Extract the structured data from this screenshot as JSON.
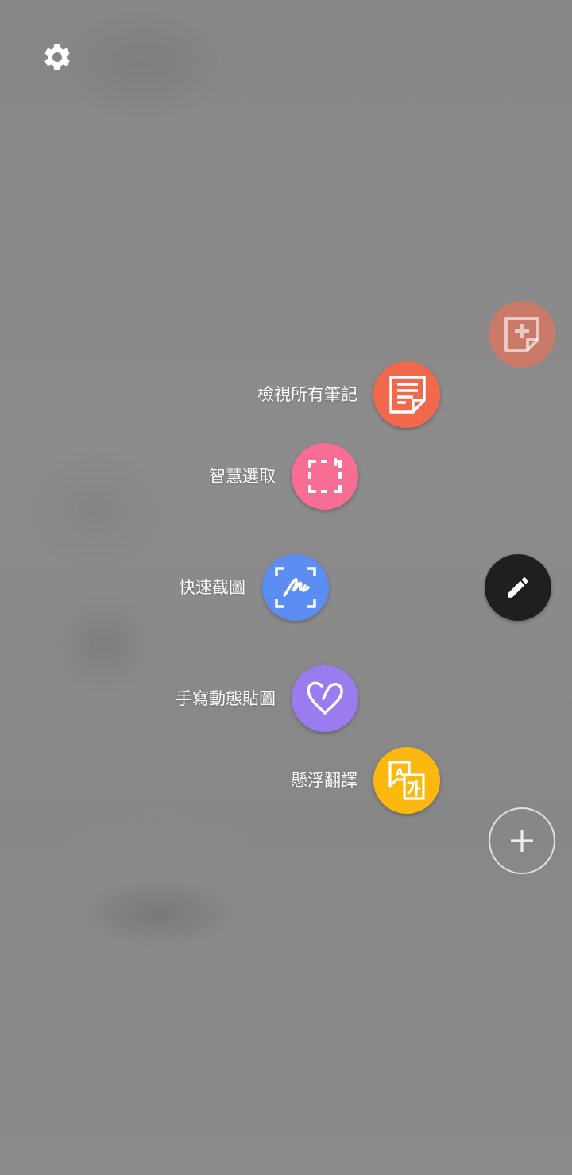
{
  "settings": {
    "icon": "gear-icon"
  },
  "air_command": {
    "create_note": {
      "icon": "note-add-icon",
      "color": "#c97a68"
    },
    "items": [
      {
        "label": "檢視所有筆記",
        "icon": "notes-list-icon",
        "color": "#f2684c"
      },
      {
        "label": "智慧選取",
        "icon": "smart-select-icon",
        "color": "#f76d94"
      },
      {
        "label": "快速截圖",
        "icon": "screen-write-icon",
        "color": "#5b8df2"
      },
      {
        "label": "手寫動態貼圖",
        "icon": "live-message-heart-icon",
        "color": "#9b7cf0"
      },
      {
        "label": "懸浮翻譯",
        "icon": "translate-icon",
        "color": "#fbb90f"
      }
    ],
    "pen_button": {
      "icon": "pen-icon",
      "color": "#1f1f1f"
    },
    "add_shortcut": {
      "icon": "plus-icon"
    }
  }
}
